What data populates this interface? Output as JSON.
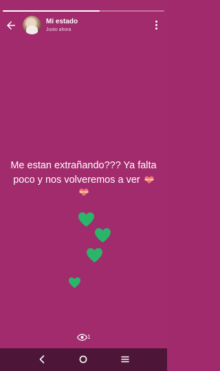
{
  "status": {
    "progress_fraction": 0.6,
    "contact_name": "Mi estado",
    "timestamp": "Justo ahora",
    "message": "Me estan extrañando??? Ya falta poco y nos volveremos a ver",
    "message_emoji": "heart-with-ribbon-icon",
    "hearts_color": "#2bb56a",
    "view_count": "1"
  },
  "colors": {
    "background": "#a22b6d",
    "navbar": "#4d1537"
  },
  "navbar": {
    "back_icon": "back-triangle-icon",
    "home_icon": "home-circle-icon",
    "recents_icon": "menu-lines-icon"
  }
}
